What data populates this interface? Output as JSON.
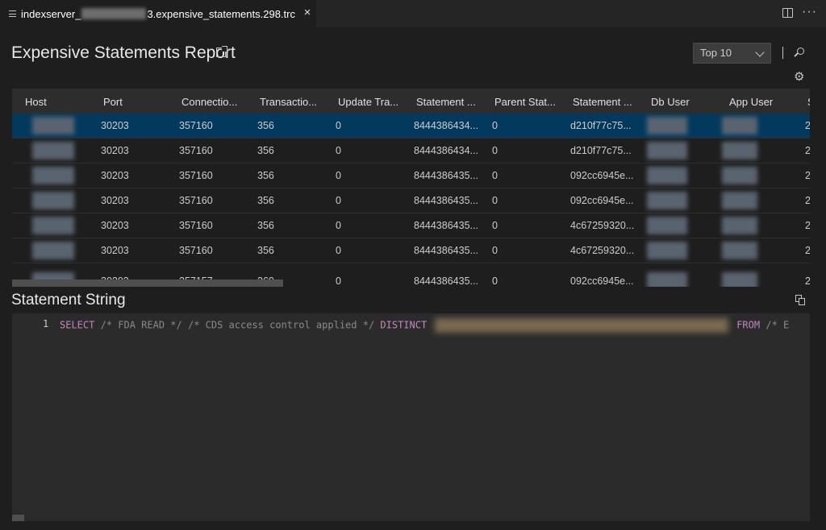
{
  "tab": {
    "title_prefix": "indexserver_",
    "title_suffix": "3.expensive_statements.298.trc",
    "close_glyph": "×"
  },
  "toolbar": {
    "more_glyph": "···"
  },
  "report": {
    "title": "Expensive Statements Report",
    "top_select": "Top 10",
    "divider_glyph": "|",
    "gear_glyph": "⚙"
  },
  "grid": {
    "columns": [
      "Host",
      "Port",
      "Connectio...",
      "Transactio...",
      "Update Tra...",
      "Statement ...",
      "Parent Stat...",
      "Statement ...",
      "Db User",
      "App User",
      "S"
    ],
    "rows": [
      {
        "port": "30203",
        "connection": "357160",
        "transaction": "356",
        "update": "0",
        "statement_id": "8444386434...",
        "parent": "0",
        "hash": "d210f77c75...",
        "last": "2",
        "selected": true
      },
      {
        "port": "30203",
        "connection": "357160",
        "transaction": "356",
        "update": "0",
        "statement_id": "8444386434...",
        "parent": "0",
        "hash": "d210f77c75...",
        "last": "2"
      },
      {
        "port": "30203",
        "connection": "357160",
        "transaction": "356",
        "update": "0",
        "statement_id": "8444386435...",
        "parent": "0",
        "hash": "092cc6945e...",
        "last": "2"
      },
      {
        "port": "30203",
        "connection": "357160",
        "transaction": "356",
        "update": "0",
        "statement_id": "8444386435...",
        "parent": "0",
        "hash": "092cc6945e...",
        "last": "2"
      },
      {
        "port": "30203",
        "connection": "357160",
        "transaction": "356",
        "update": "0",
        "statement_id": "8444386435...",
        "parent": "0",
        "hash": "4c67259320...",
        "last": "2"
      },
      {
        "port": "30203",
        "connection": "357160",
        "transaction": "356",
        "update": "0",
        "statement_id": "8444386435...",
        "parent": "0",
        "hash": "4c67259320...",
        "last": "2"
      },
      {
        "port": "30203",
        "connection": "357157",
        "transaction": "360",
        "update": "0",
        "statement_id": "8444386435...",
        "parent": "0",
        "hash": "092cc6945e...",
        "last": "2"
      }
    ]
  },
  "statement": {
    "title": "Statement String",
    "line_number": "1",
    "kw_select": "SELECT",
    "comment1": "/* FDA READ */",
    "comment2": "/* CDS access control applied */",
    "kw_distinct": "DISTINCT",
    "kw_from": "FROM",
    "comment3": "/* E"
  }
}
